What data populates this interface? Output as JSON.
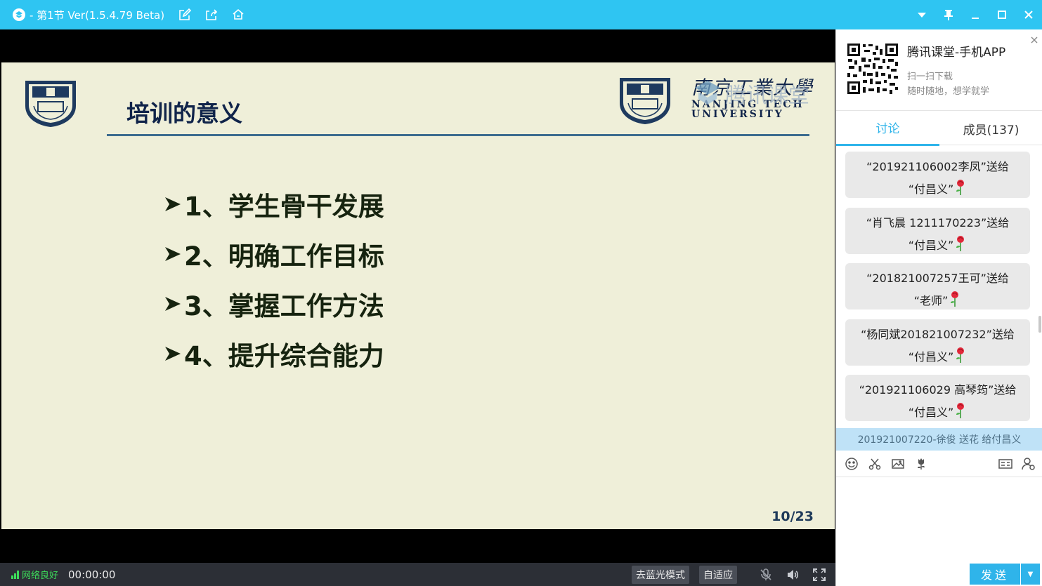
{
  "window": {
    "title": "- 第1节 Ver(1.5.4.79 Beta)",
    "accent_color": "#2fc5f2"
  },
  "slide": {
    "title": "培训的意义",
    "university_cn": "南京工業大學",
    "university_en_line1": "NANJING TECH",
    "university_en_line2": "UNIVERSITY",
    "watermark": "腾讯课堂",
    "bullets": [
      "1、学生骨干发展",
      "2、明确工作目标",
      "3、掌握工作方法",
      "4、提升综合能力"
    ],
    "page": "10/23"
  },
  "bottom_bar": {
    "network_status": "网络良好",
    "timer": "00:00:00",
    "blue_light_button": "去蓝光模式",
    "fit_button": "自适应"
  },
  "side_panel": {
    "app_name": "腾讯课堂-手机APP",
    "app_sub1": "扫一扫下载",
    "app_sub2": "随时随地，想学就学",
    "tabs": [
      {
        "label": "讨论",
        "active": true
      },
      {
        "label": "成员(137)",
        "active": false
      }
    ],
    "messages": [
      {
        "line1": "“201921106002李凤”送给",
        "line2": "“付昌义”"
      },
      {
        "line1": "“肖飞晨 1211170223”送给",
        "line2": "“付昌义”"
      },
      {
        "line1": "“201821007257王可”送给",
        "line2": "“老师”"
      },
      {
        "line1": "“杨同斌201821007232”送给",
        "line2": "“付昌义”"
      },
      {
        "line1": "“201921106029 高琴筠”送给",
        "line2": "“付昌义”"
      }
    ],
    "notice": "201921007220-徐俊 送花 给付昌义",
    "send_label": "发送",
    "send_dropdown": "▼"
  }
}
